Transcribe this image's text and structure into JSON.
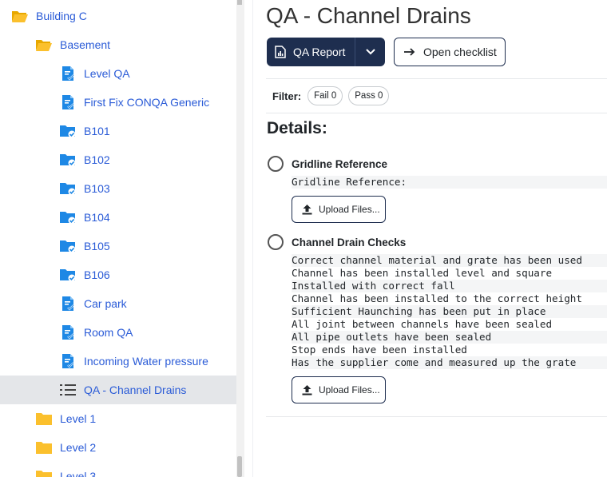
{
  "sidebar": {
    "items": [
      {
        "label": "Building C",
        "icon": "folder-open-icon",
        "level": 0
      },
      {
        "label": "Basement",
        "icon": "folder-open-icon",
        "level": 1
      },
      {
        "label": "Level QA",
        "icon": "checklist-doc-icon",
        "level": 2
      },
      {
        "label": "First Fix CONQA Generic",
        "icon": "checklist-doc-icon",
        "level": 2
      },
      {
        "label": "B101",
        "icon": "folder-check-icon",
        "level": 2
      },
      {
        "label": "B102",
        "icon": "folder-check-icon",
        "level": 2
      },
      {
        "label": "B103",
        "icon": "folder-check-icon",
        "level": 2
      },
      {
        "label": "B104",
        "icon": "folder-check-icon",
        "level": 2
      },
      {
        "label": "B105",
        "icon": "folder-check-icon",
        "level": 2
      },
      {
        "label": "B106",
        "icon": "folder-check-icon",
        "level": 2
      },
      {
        "label": "Car park",
        "icon": "checklist-doc-icon",
        "level": 2
      },
      {
        "label": "Room QA",
        "icon": "checklist-doc-icon",
        "level": 2
      },
      {
        "label": "Incoming Water pressure",
        "icon": "checklist-doc-icon",
        "level": 2
      },
      {
        "label": "QA - Channel Drains",
        "icon": "list-icon",
        "level": 2,
        "active": true
      },
      {
        "label": "Level 1",
        "icon": "folder-icon",
        "level": 1
      },
      {
        "label": "Level 2",
        "icon": "folder-icon",
        "level": 1
      },
      {
        "label": "Level 3",
        "icon": "folder-icon",
        "level": 1
      }
    ]
  },
  "main": {
    "title": "QA - Channel Drains",
    "qa_report_label": "QA Report",
    "open_checklist_label": "Open checklist",
    "filter": {
      "label": "Filter:",
      "fail_label": "Fail 0",
      "pass_label": "Pass 0"
    },
    "details_title": "Details:",
    "checks": [
      {
        "title": "Gridline Reference",
        "lines": [
          "Gridline Reference:"
        ],
        "upload_label": "Upload Files..."
      },
      {
        "title": "Channel Drain Checks",
        "lines": [
          "Correct channel material and grate has been used",
          "Channel has been installed level and square",
          "Installed with correct fall",
          "Channel has been installed to the correct height",
          "Sufficient Haunching has been put in place",
          "All joint between channels have been sealed",
          "All pipe outlets have been sealed",
          "Stop ends have been installed",
          "Has the supplier come and measured up the grate"
        ],
        "upload_label": "Upload Files..."
      }
    ]
  },
  "colors": {
    "link": "#2a5bd7",
    "folder": "#f5b800",
    "icon_blue": "#1e88e5",
    "dark_button": "#1e2e4f",
    "active_row": "#e4e6e9"
  }
}
